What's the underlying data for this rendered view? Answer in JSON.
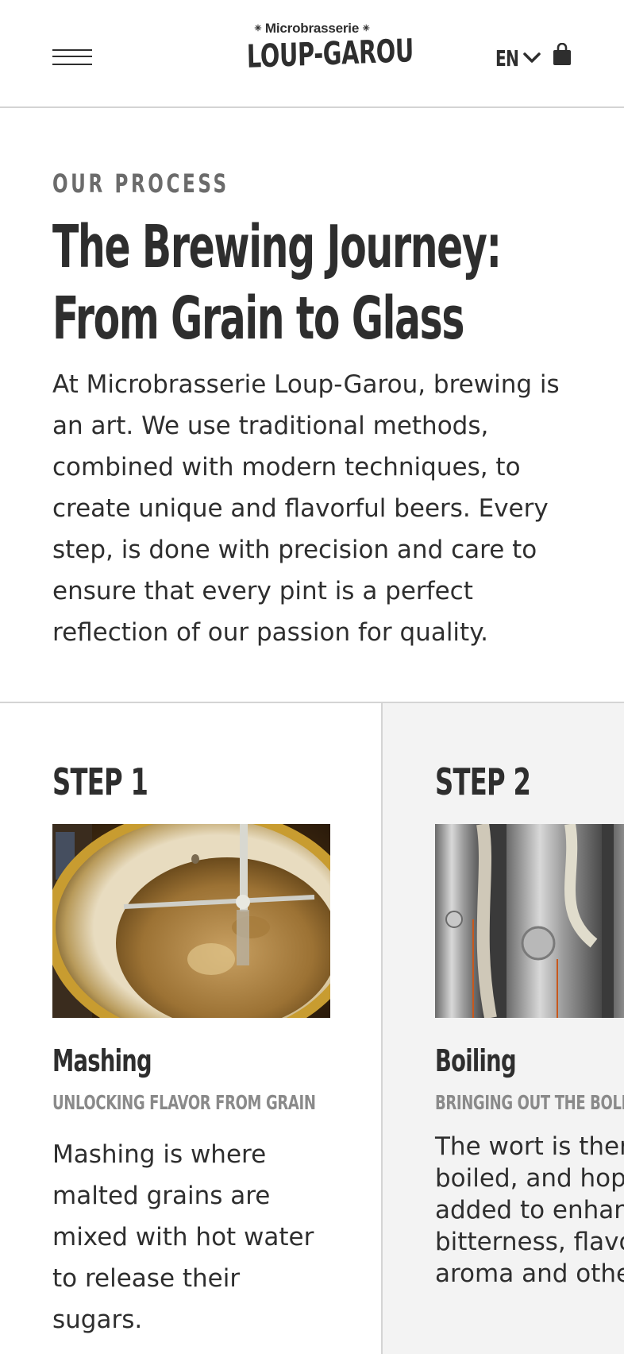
{
  "header": {
    "logo_top": "Microbrasserie",
    "logo_main": "LOUP-GAROU",
    "language": "EN",
    "icons": {
      "menu": "hamburger-menu-icon",
      "language": "chevron-down-icon",
      "cart": "shopping-bag-icon"
    }
  },
  "hero": {
    "eyebrow": "OUR PROCESS",
    "title_line1": "The Brewing Journey:",
    "title_line2": "From Grain to Glass",
    "intro": "At Microbrasserie Loup-Garou, brewing is an art. We use traditional methods, combined with modern techniques, to create unique and flavorful beers. Every step, is done with precision and care to ensure that every pint is a perfect reflection of our passion for quality."
  },
  "steps": [
    {
      "number": "STEP 1",
      "name": "Mashing",
      "subtitle": "UNLOCKING FLAVOR FROM GRAIN",
      "description": "Mashing is where malted grains are mixed with hot water to release their sugars.",
      "image": "mash-tun-photo"
    },
    {
      "number": "STEP 2",
      "name": "Boiling",
      "subtitle": "BRINGING OUT THE BOLD F",
      "description_lines": [
        "The wort is then",
        "boiled, and hops",
        "added to enhanc",
        "bitterness, flavo",
        "aroma and other"
      ],
      "image": "fermentation-tanks-photo"
    }
  ],
  "colors": {
    "text": "#2e2e2e",
    "eyebrow": "#6b6b6b",
    "subtitle": "#8a8a8a",
    "divider": "#d4d4d4",
    "step_alt_bg": "#f3f3f3"
  }
}
